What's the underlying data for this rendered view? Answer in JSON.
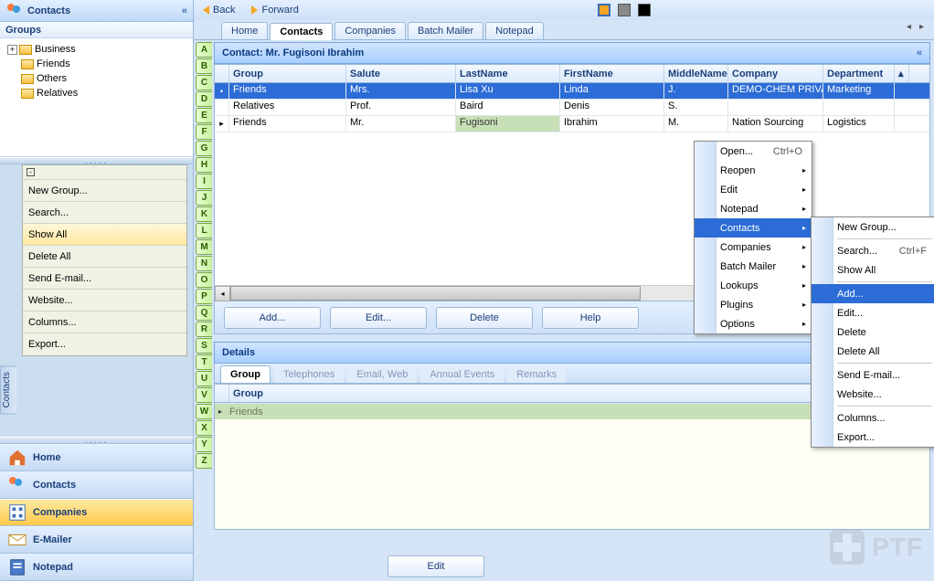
{
  "sidebar": {
    "title": "Contacts",
    "groups_label": "Groups",
    "tree": [
      "Business",
      "Friends",
      "Others",
      "Relatives"
    ],
    "actions": [
      "New Group...",
      "Search...",
      "Show All",
      "Delete All",
      "Send E-mail...",
      "Website...",
      "Columns...",
      "Export..."
    ],
    "action_selected_index": 2,
    "vtab": "Contacts",
    "nav": [
      "Home",
      "Contacts",
      "Companies",
      "E-Mailer",
      "Notepad"
    ]
  },
  "toolbar": {
    "back": "Back",
    "forward": "Forward"
  },
  "tabs": [
    "Home",
    "Contacts",
    "Companies",
    "Batch Mailer",
    "Notepad"
  ],
  "active_tab": 1,
  "alpha": [
    "A",
    "B",
    "C",
    "D",
    "E",
    "F",
    "G",
    "H",
    "I",
    "J",
    "K",
    "L",
    "M",
    "N",
    "O",
    "P",
    "Q",
    "R",
    "S",
    "T",
    "U",
    "V",
    "W",
    "X",
    "Y",
    "Z"
  ],
  "contact_header": "Contact: Mr. Fugisoni Ibrahim",
  "columns": [
    "Group",
    "Salute",
    "LastName",
    "FirstName",
    "MiddleName",
    "Company",
    "Department"
  ],
  "rows": [
    {
      "group": "Friends",
      "salute": "Mrs.",
      "last": "Lisa Xu",
      "first": "Linda",
      "mid": "J.",
      "company": "DEMO-CHEM PRIVA",
      "dept": "Marketing",
      "sel": true
    },
    {
      "group": "Relatives",
      "salute": "Prof.",
      "last": "Baird",
      "first": "Denis",
      "mid": "S.",
      "company": "",
      "dept": ""
    },
    {
      "group": "Friends",
      "salute": "Mr.",
      "last": "Fugisoni",
      "first": "Ibrahim",
      "mid": "M.",
      "company": "Nation Sourcing",
      "dept": "Logistics",
      "edit": true
    }
  ],
  "buttons": {
    "add": "Add...",
    "edit": "Edit...",
    "delete": "Delete",
    "help": "Help"
  },
  "menu1": [
    {
      "label": "Open...",
      "shortcut": "Ctrl+O"
    },
    {
      "label": "Reopen",
      "sub": true
    },
    {
      "label": "Edit",
      "sub": true
    },
    {
      "label": "Notepad",
      "sub": true
    },
    {
      "label": "Contacts",
      "sub": true,
      "hl": true
    },
    {
      "label": "Companies",
      "sub": true
    },
    {
      "label": "Batch Mailer",
      "sub": true
    },
    {
      "label": "Lookups",
      "sub": true
    },
    {
      "label": "Plugins",
      "sub": true
    },
    {
      "label": "Options",
      "sub": true
    }
  ],
  "menu2": [
    {
      "label": "New Group..."
    },
    {
      "sep": true
    },
    {
      "label": "Search...",
      "shortcut": "Ctrl+F"
    },
    {
      "label": "Show All"
    },
    {
      "sep": true
    },
    {
      "label": "Add...",
      "hl": true
    },
    {
      "label": "Edit..."
    },
    {
      "label": "Delete"
    },
    {
      "label": "Delete All"
    },
    {
      "sep": true
    },
    {
      "label": "Send E-mail..."
    },
    {
      "label": "Website..."
    },
    {
      "sep": true
    },
    {
      "label": "Columns..."
    },
    {
      "label": "Export..."
    }
  ],
  "details": {
    "title": "Details",
    "tabs": [
      "Group",
      "Telephones",
      "Email, Web",
      "Annual Events",
      "Remarks"
    ],
    "header": "Group",
    "value": "Friends",
    "bottom_button": "Edit"
  },
  "watermark": "PTF"
}
